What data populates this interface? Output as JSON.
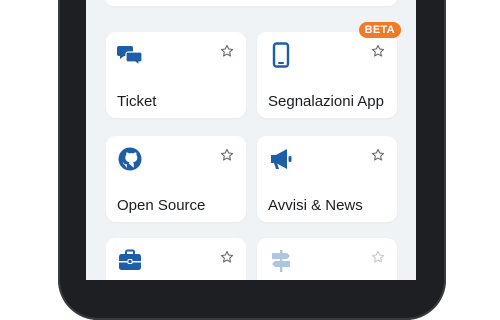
{
  "colors": {
    "accent": "#1c5ea8",
    "badge": "#ef7b27",
    "background": "#f0f3f6"
  },
  "tiles": [
    {
      "label": "Ticket",
      "icon": "chat-bubbles-icon",
      "favorite": false
    },
    {
      "label": "Segnalazioni App",
      "icon": "smartphone-icon",
      "favorite": false,
      "badge": "BETA"
    },
    {
      "label": "Open Source",
      "icon": "github-icon",
      "favorite": false
    },
    {
      "label": "Avvisi & News",
      "icon": "megaphone-icon",
      "favorite": false
    },
    {
      "label": "",
      "icon": "briefcase-icon",
      "favorite": false
    },
    {
      "label": "",
      "icon": "signpost-icon",
      "favorite": false
    }
  ]
}
